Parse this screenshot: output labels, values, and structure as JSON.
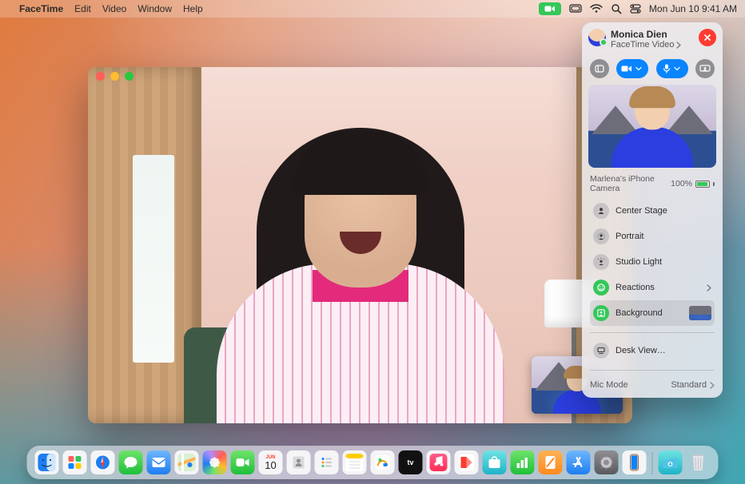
{
  "menubar": {
    "app": "FaceTime",
    "items": [
      "Edit",
      "Video",
      "Window",
      "Help"
    ],
    "clock": "Mon Jun 10  9:41 AM"
  },
  "panel": {
    "caller_name": "Monica Dien",
    "call_type": "FaceTime Video",
    "camera_label": "Marlena's iPhone Camera",
    "battery_pct": "100%",
    "options": {
      "center_stage": "Center Stage",
      "portrait": "Portrait",
      "studio_light": "Studio Light",
      "reactions": "Reactions",
      "background": "Background",
      "desk_view": "Desk View…"
    },
    "mic_mode_label": "Mic Mode",
    "mic_mode_value": "Standard"
  },
  "dock": {
    "apps": [
      "finder",
      "launchpad",
      "safari",
      "messages",
      "mail",
      "maps",
      "photos",
      "facetime",
      "calendar",
      "contacts",
      "reminders",
      "notes",
      "freeform",
      "tv",
      "music",
      "news",
      "appstore-alt",
      "numbers",
      "pages",
      "appstore",
      "settings",
      "iphone-mirroring"
    ],
    "calendar_day": "10",
    "calendar_mon": "JUN"
  }
}
